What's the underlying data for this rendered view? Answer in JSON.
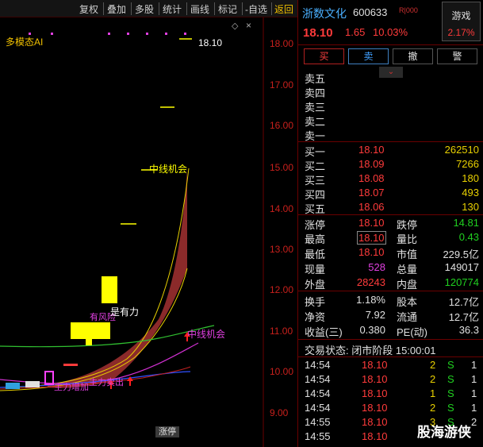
{
  "toolbar": {
    "items": [
      "复权",
      "叠加",
      "多股",
      "统计",
      "画线",
      "标记",
      "-自选",
      "返回"
    ]
  },
  "chart": {
    "ai_title": "多模态AI",
    "settings_icon": "diamond-icon",
    "close_symbol": "×",
    "price_axis": [
      "18.00",
      "17.00",
      "16.00",
      "15.00",
      "14.00",
      "13.00",
      "12.00",
      "11.00",
      "10.00",
      "9.00"
    ],
    "high_marker": "18.10",
    "annotations": {
      "mid_line_opportunity_top": "中线机会",
      "mid_line_opportunity": "中线机会",
      "risky": "有风险",
      "has_power": "是有力",
      "main_inflow": "主力增加",
      "main_sell": "主力卖出"
    },
    "bottom_tag": "涨停"
  },
  "stock": {
    "name": "浙数文化",
    "code": "600633",
    "flag": "R|000",
    "price": "18.10",
    "change": "1.65",
    "change_pct": "10.03%",
    "game_label": "游戏",
    "game_pct": "2.17%"
  },
  "actions": {
    "buy": "买",
    "sell": "卖",
    "cancel": "撤",
    "alert": "警",
    "collapse": "⌄"
  },
  "order_book": {
    "asks": [
      {
        "label": "卖五",
        "price": "",
        "volume": ""
      },
      {
        "label": "卖四",
        "price": "",
        "volume": ""
      },
      {
        "label": "卖三",
        "price": "",
        "volume": ""
      },
      {
        "label": "卖二",
        "price": "",
        "volume": ""
      },
      {
        "label": "卖一",
        "price": "",
        "volume": ""
      }
    ],
    "bids": [
      {
        "label": "买一",
        "price": "18.10",
        "volume": "262510"
      },
      {
        "label": "买二",
        "price": "18.09",
        "volume": "7266"
      },
      {
        "label": "买三",
        "price": "18.08",
        "volume": "180"
      },
      {
        "label": "买四",
        "price": "18.07",
        "volume": "493"
      },
      {
        "label": "买五",
        "price": "18.06",
        "volume": "130"
      }
    ]
  },
  "quote_stats": {
    "limit_up_label": "涨停",
    "limit_up": "18.10",
    "limit_down_label": "跌停",
    "limit_down": "14.81",
    "high_label": "最高",
    "high": "18.10",
    "vol_ratio_label": "量比",
    "vol_ratio": "0.43",
    "low_label": "最低",
    "low": "18.10",
    "mktcap_label": "市值",
    "mktcap": "229.5亿",
    "last_vol_label": "现量",
    "last_vol": "528",
    "total_vol_label": "总量",
    "total_vol": "149017",
    "outer_label": "外盘",
    "outer": "28243",
    "inner_label": "内盘",
    "inner": "120774",
    "turnover_label": "换手",
    "turnover": "1.18%",
    "shares_label": "股本",
    "shares": "12.7亿",
    "nav_label": "净资",
    "nav": "7.92",
    "float_label": "流通",
    "float": "12.7亿",
    "eps_label": "收益(三)",
    "eps": "0.380",
    "pe_label": "PE(动)",
    "pe": "36.3"
  },
  "trade_status": "交易状态: 闭市阶段 15:00:01",
  "ticks": [
    {
      "time": "14:54",
      "price": "18.10",
      "vol": "2",
      "dir": "S",
      "count": "1"
    },
    {
      "time": "14:54",
      "price": "18.10",
      "vol": "2",
      "dir": "S",
      "count": "1"
    },
    {
      "time": "14:54",
      "price": "18.10",
      "vol": "1",
      "dir": "S",
      "count": "1"
    },
    {
      "time": "14:54",
      "price": "18.10",
      "vol": "2",
      "dir": "S",
      "count": "1"
    },
    {
      "time": "14:55",
      "price": "18.10",
      "vol": "3",
      "dir": "S",
      "count": "2"
    },
    {
      "time": "14:55",
      "price": "18.10",
      "vol": "",
      "dir": "",
      "count": ""
    }
  ],
  "watermark": "股海游侠",
  "colors": {
    "up": "#ff3b3b",
    "down": "#20d020",
    "accent": "#f0c000",
    "link": "#4ab0ff",
    "cloud": "#8b2a2a"
  }
}
